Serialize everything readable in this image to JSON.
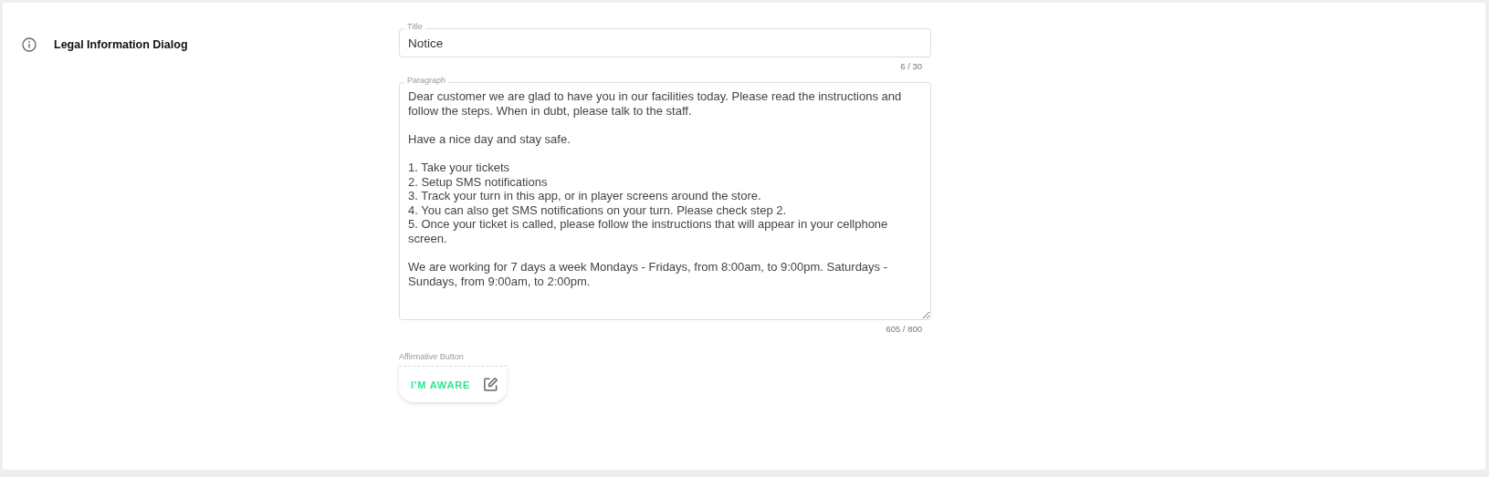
{
  "section": {
    "title": "Legal Information Dialog"
  },
  "title_field": {
    "label": "Title",
    "value": "Notice",
    "counter": "6 / 30"
  },
  "paragraph_field": {
    "label": "Paragraph",
    "value": "Dear customer we are glad to have you in our facilities today. Please read the instructions and follow the steps. When in dubt, please talk to the staff.\n\nHave a nice day and stay safe.\n\n1. Take your tickets\n2. Setup SMS notifications\n3. Track your turn in this app, or in player screens around the store.\n4. You can also get SMS notifications on your turn. Please check step 2.\n5. Once your ticket is called, please follow the instructions that will appear in your cellphone screen.\n\nWe are working for 7 days a week Mondays - Fridays, from 8:00am, to 9:00pm. Saturdays - Sundays, from 9:00am, to 2:00pm.",
    "counter": "605 / 800"
  },
  "affirmative_button": {
    "label": "Affirmative Button",
    "text": "I'M AWARE"
  }
}
